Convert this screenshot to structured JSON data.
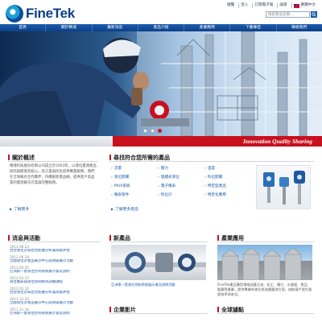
{
  "brand": {
    "name": "FineTek"
  },
  "utility_links": [
    "總覽",
    "登入",
    "訂閱電子報",
    "論壇",
    "繁體中文"
  ],
  "search": {
    "placeholder": "搜索產品名稱"
  },
  "nav": [
    "首頁",
    "關於精達",
    "最新消息",
    "產品介紹",
    "產業應用",
    "下載專區",
    "聯絡我們"
  ],
  "hero": {
    "slide_count": 3,
    "active_slide": 3
  },
  "tagline": "Innovation Quality Sharing",
  "about": {
    "title": "關於概述",
    "text": "精達科技股份有限公司成立於2003年，以液位量測產品研究與開發為核心，為工業與民生提供專業服務。我們在全球擁有合作夥伴，持續創新產品線，提供客戶高品質的量測解決方案與完整服務。",
    "more": "了解更多"
  },
  "products": {
    "title": "尋找符合您所需的產品",
    "items": [
      "流量",
      "壓力",
      "溫度",
      "液位開關",
      "連續式液位",
      "料位開關",
      "MUX系統",
      "電子儀表",
      "特定型產品",
      "儀表管件",
      "料位計",
      "特定化應用"
    ],
    "more": "了解更多產品"
  },
  "news": {
    "title": "消息與活動",
    "items": [
      {
        "date": "2012.08.23",
        "title": "台塑液位計與台塑氣體分析器測試評估"
      },
      {
        "date": "2012.06.19",
        "title": "全國液位計產品展示中心說明與展示活動"
      },
      {
        "date": "2012.04.20",
        "title": "亞洲第一套液位控制系統展示會及說明"
      },
      {
        "date": "2012.03.15",
        "title": "液位儀表與液位管制教育訓練課程"
      },
      {
        "date": "2012.02.10",
        "title": "台塑液位計與台塑氣體分析器測試評估"
      },
      {
        "date": "2011.12.20",
        "title": "全國液位計產品展示中心說明與展示活動"
      },
      {
        "date": "2011.11.18",
        "title": "亞洲第一套液位控制系統展示會及說明"
      }
    ]
  },
  "new_products": {
    "title": "新產品",
    "caption": "亞洲第一套液位控制系統展示會及說明活動"
  },
  "industry": {
    "title": "產業應用",
    "text": "FineTek產品應用領域涵蓋石油、化工、電力、水處理、食品、製藥等產業，提供專業的液位與流量量測方案，協助客戶提升製程效率與安全。"
  },
  "videos": {
    "title": "企業影片"
  },
  "global": {
    "title": "全球據點"
  }
}
